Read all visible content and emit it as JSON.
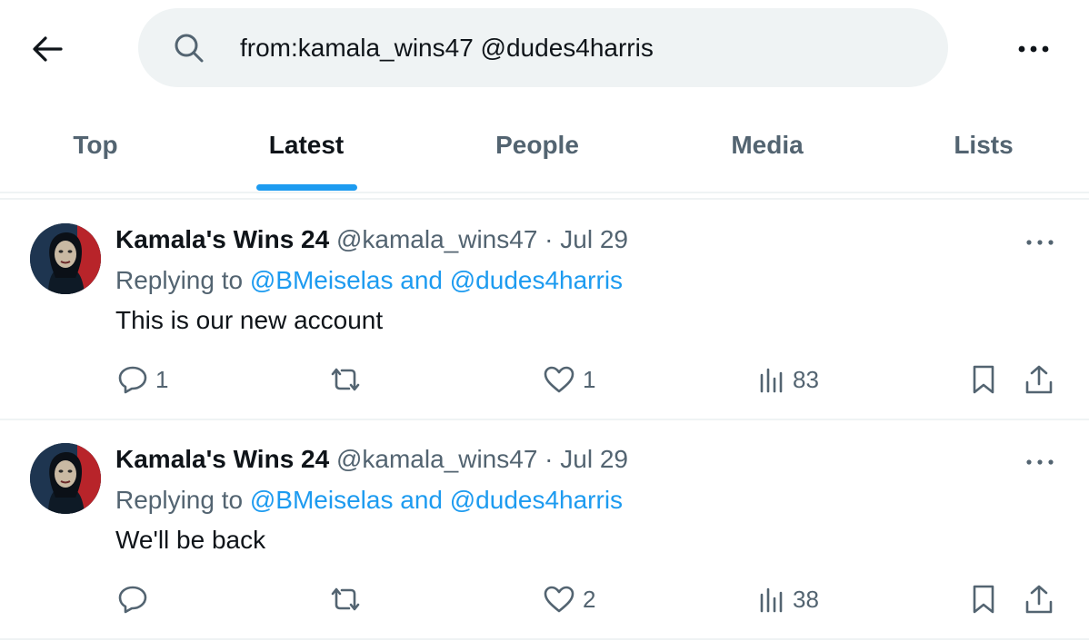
{
  "header": {
    "back_icon": "arrow-left-icon",
    "search_icon": "search-icon",
    "search_value": "from:kamala_wins47 @dudes4harris",
    "more_icon": "more-horizontal-icon"
  },
  "tabs": [
    {
      "label": "Top",
      "active": false
    },
    {
      "label": "Latest",
      "active": true
    },
    {
      "label": "People",
      "active": false
    },
    {
      "label": "Media",
      "active": false
    },
    {
      "label": "Lists",
      "active": false
    }
  ],
  "colors": {
    "accent": "#1d9bf0",
    "text": "#0f1419",
    "secondary": "#536471",
    "search_bg": "#eff3f4"
  },
  "tweets": [
    {
      "name": "Kamala's Wins 24",
      "handle": "@kamala_wins47",
      "date": "Jul 29",
      "reply_prefix": "Replying to",
      "reply_to_1": "@BMeiselas",
      "reply_and": "and",
      "reply_to_2": "@dudes4harris",
      "text": "This is our new account",
      "replies": "1",
      "retweets": "",
      "likes": "1",
      "views": "83"
    },
    {
      "name": "Kamala's Wins 24",
      "handle": "@kamala_wins47",
      "date": "Jul 29",
      "reply_prefix": "Replying to",
      "reply_to_1": "@BMeiselas",
      "reply_and": "and",
      "reply_to_2": "@dudes4harris",
      "text": "We'll be back",
      "replies": "",
      "retweets": "",
      "likes": "2",
      "views": "38"
    }
  ]
}
